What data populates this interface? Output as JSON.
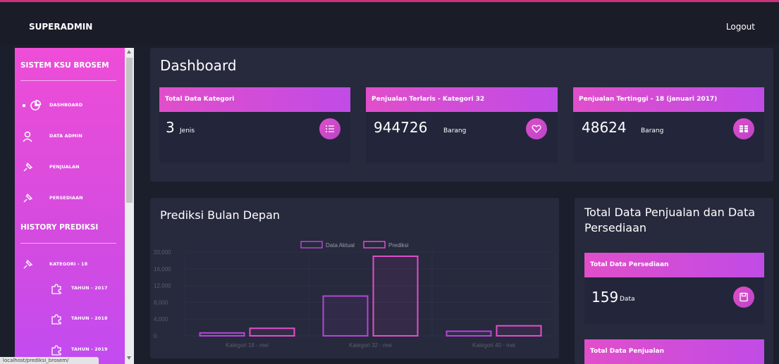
{
  "topbar": {
    "brand": "SUPERADMIN",
    "logout": "Logout"
  },
  "sidebar": {
    "section1": "SISTEM KSU BROSEM",
    "items": [
      {
        "label": "DASHBOARD",
        "icon": "pie-chart-icon",
        "active": true
      },
      {
        "label": "DATA ADMIN",
        "icon": "user-icon"
      },
      {
        "label": "PENJUALAN",
        "icon": "pin-icon"
      },
      {
        "label": "PERSEDIAAN",
        "icon": "pin-icon"
      }
    ],
    "section2": "HISTORY PREDIKSI",
    "history": [
      {
        "label": "KATEGORI - 18",
        "icon": "pin-icon"
      },
      {
        "label": "TAHUN - 2017",
        "icon": "puzzle-icon"
      },
      {
        "label": "TAHUN - 2018",
        "icon": "puzzle-icon"
      },
      {
        "label": "TAHUN - 2019",
        "icon": "puzzle-icon"
      }
    ]
  },
  "status_url": "localhost/prediksi_brosem/",
  "dashboard": {
    "title": "Dashboard",
    "cards": [
      {
        "header": "Total Data Kategori",
        "value": "3",
        "unit": "Jenis",
        "icon": "list-icon"
      },
      {
        "header": "Penjualan Terlaris - Kategori 32",
        "value": "944726",
        "unit": "Barang",
        "icon": "heart-icon"
      },
      {
        "header": "Penjualan Tertinggi - 18 (januari 2017)",
        "value": "48624",
        "unit": "Barang",
        "icon": "coins-icon"
      }
    ]
  },
  "prediction": {
    "title": "Prediksi Bulan Depan"
  },
  "totals": {
    "title": "Total Data Penjualan dan Data Persediaan",
    "cards": [
      {
        "header": "Total Data Persediaan",
        "value": "159",
        "unit": "Data",
        "icon": "save-icon"
      },
      {
        "header": "Total Data Penjualan"
      }
    ]
  },
  "colors": {
    "accent": "#e14eca",
    "panel": "#27293d",
    "background": "#1b1e2b"
  },
  "chart_data": {
    "type": "bar",
    "categories": [
      "Kategori 18 - mei",
      "Kategori 32 - mei",
      "Kategori 40 - mei"
    ],
    "series": [
      {
        "name": "Data Aktual",
        "values": [
          700,
          9500,
          1100
        ],
        "color": "#b545d6"
      },
      {
        "name": "Prediksi",
        "values": [
          1800,
          19000,
          2400
        ],
        "color": "#e14eca"
      }
    ],
    "yticks": [
      "0",
      "4,000",
      "8,000",
      "12,000",
      "16,000",
      "20,000"
    ],
    "ylim": [
      0,
      20000
    ],
    "legend": "top-center",
    "grid": true
  }
}
